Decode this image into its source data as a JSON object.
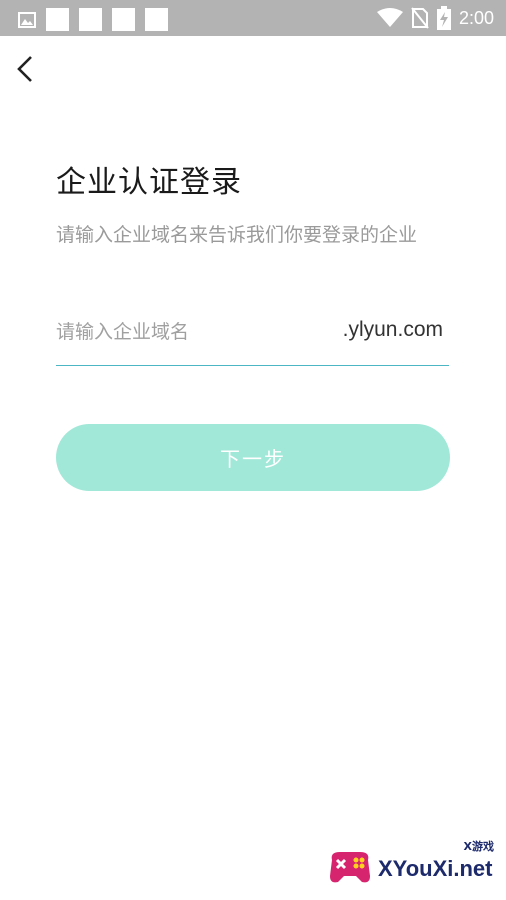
{
  "status_bar": {
    "time": "2:00",
    "icons": [
      "image-icon",
      "notification-square-icon",
      "wifi-icon",
      "no-sim-icon",
      "battery-charging-icon"
    ]
  },
  "navigation": {
    "back_icon": "chevron-left-icon"
  },
  "login": {
    "title": "企业认证登录",
    "subtitle": "请输入企业域名来告诉我们你要登录的企业",
    "domain_placeholder": "请输入企业域名",
    "domain_value": "",
    "domain_suffix": ".ylyun.com",
    "next_label": "下一步"
  },
  "watermark": {
    "text": "XYouXi.net",
    "small": "X游戏"
  },
  "colors": {
    "accent": "#4db6c4",
    "button_bg": "#a1e8d8",
    "status_bar": "#b3b3b3"
  }
}
